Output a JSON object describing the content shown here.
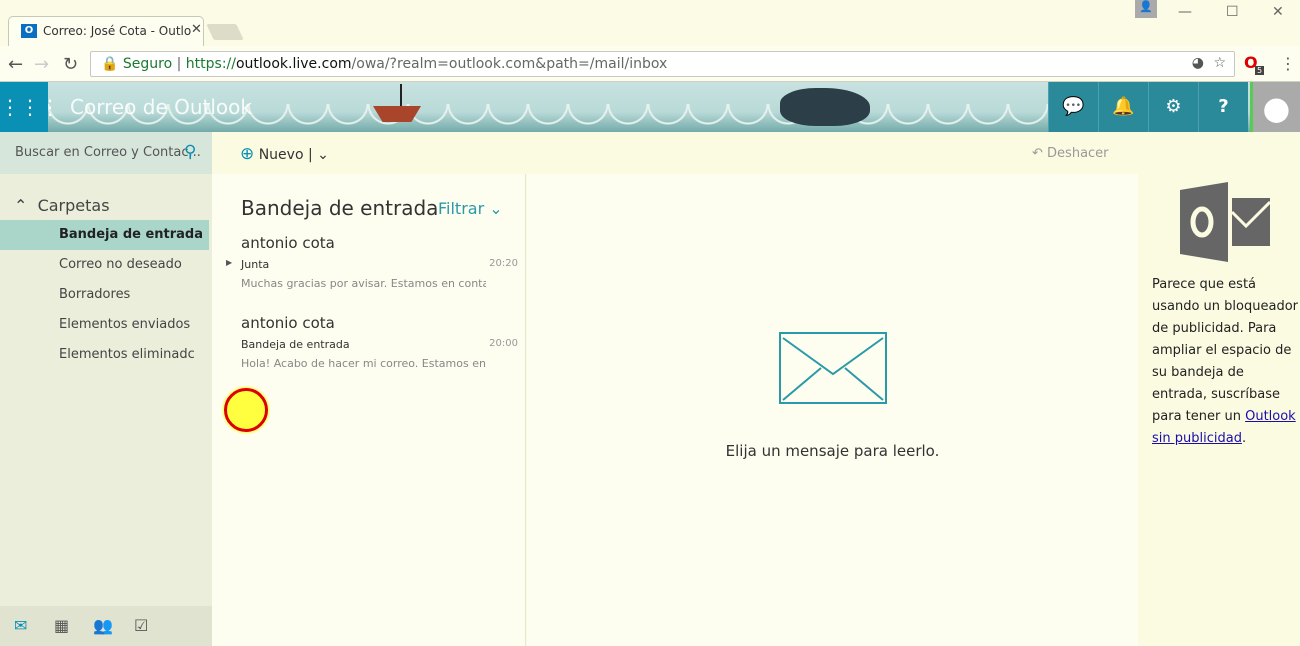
{
  "browser": {
    "tab_title": "Correo: José Cota - Outlo",
    "tab_icon": "O",
    "secure_label": "Seguro",
    "url_scheme": "https://",
    "url_host": "outlook.live.com",
    "url_path": "/owa/?realm=outlook.com&path=/mail/inbox",
    "extension_badge": "5"
  },
  "header": {
    "brand": "Correo de Outlook"
  },
  "sidebar": {
    "search_placeholder": "Buscar en Correo y Contac...",
    "folders_label": "Carpetas",
    "folders": [
      {
        "label": "Bandeja de entrada",
        "selected": true
      },
      {
        "label": "Correo no deseado"
      },
      {
        "label": "Borradores"
      },
      {
        "label": "Elementos enviados"
      },
      {
        "label": "Elementos eliminadc"
      }
    ]
  },
  "toolbar": {
    "new_label": "Nuevo",
    "undo_label": "Deshacer"
  },
  "list": {
    "title": "Bandeja de entrada",
    "filter_label": "Filtrar",
    "messages": [
      {
        "sender": "antonio cota",
        "subject": "Junta",
        "time": "20:20",
        "preview": "Muchas gracias por avisar. Estamos en contac.."
      },
      {
        "sender": "antonio cota",
        "subject": "Bandeja de entrada",
        "time": "20:00",
        "preview": "Hola! Acabo de hacer mi correo. Estamos en ..."
      }
    ]
  },
  "reading": {
    "empty_text": "Elija un mensaje para leerlo."
  },
  "ad": {
    "text": "Parece que está usando un bloqueador de publicidad. Para ampliar el espacio de su bandeja de entrada, suscríbase para tener un ",
    "link": "Outlook sin publicidad",
    "end": "."
  }
}
